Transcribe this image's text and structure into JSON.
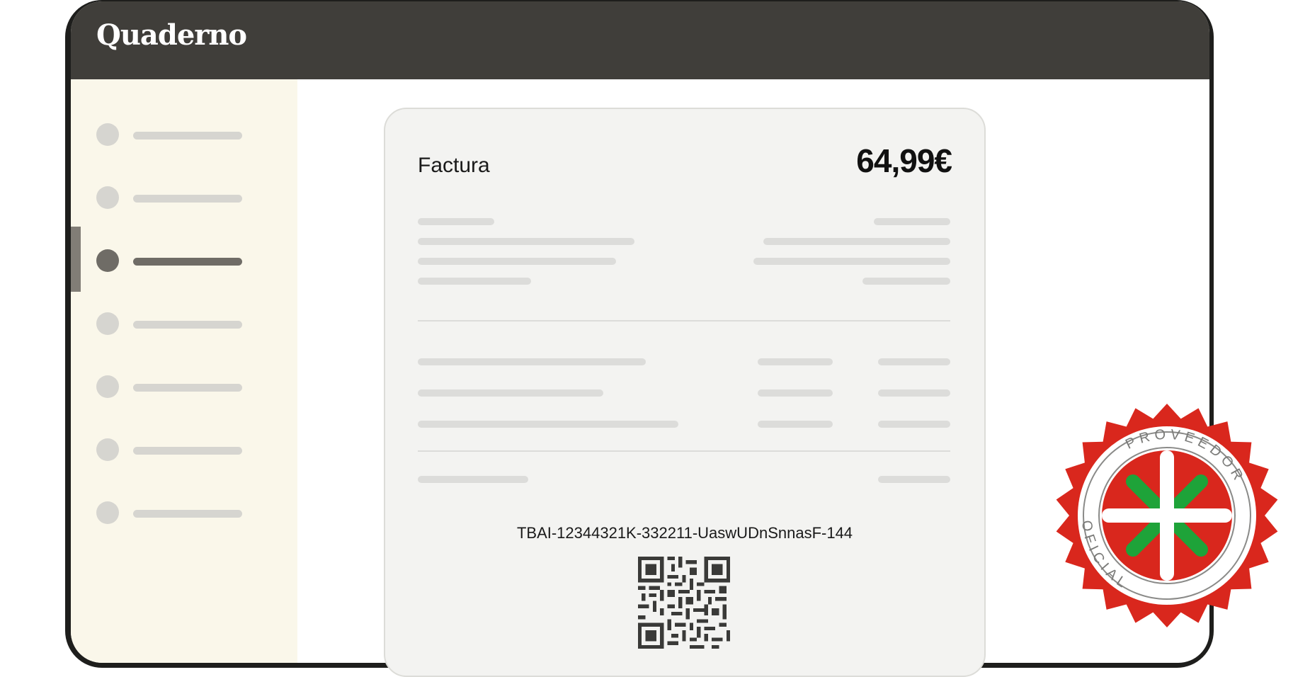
{
  "app": {
    "logo": "Quaderno"
  },
  "sidebar": {
    "items": [
      {
        "name": "item-1",
        "active": false
      },
      {
        "name": "item-2",
        "active": false
      },
      {
        "name": "item-3",
        "active": true
      },
      {
        "name": "item-4",
        "active": false
      },
      {
        "name": "item-5",
        "active": false
      },
      {
        "name": "item-6",
        "active": false
      },
      {
        "name": "item-7",
        "active": false
      }
    ]
  },
  "invoice": {
    "title": "Factura",
    "amount": "64,99€",
    "tbai_code": "TBAI-12344321K-332211-UaswUDnSnnasF-144",
    "qr_icon": "qr-code-icon"
  },
  "seal": {
    "top_text": "PROVEEDOR",
    "bottom_text": "OFICIAL",
    "icon": "basque-cross-seal-icon",
    "colors": {
      "red": "#d9271d",
      "green": "#1ea339",
      "white": "#ffffff"
    }
  },
  "colors": {
    "topbar": "#403e3a",
    "sidebar": "#faf7ea",
    "invoice_bg": "#f3f3f1",
    "placeholder": "#dcdcda",
    "active_nav": "#6f6c66"
  }
}
